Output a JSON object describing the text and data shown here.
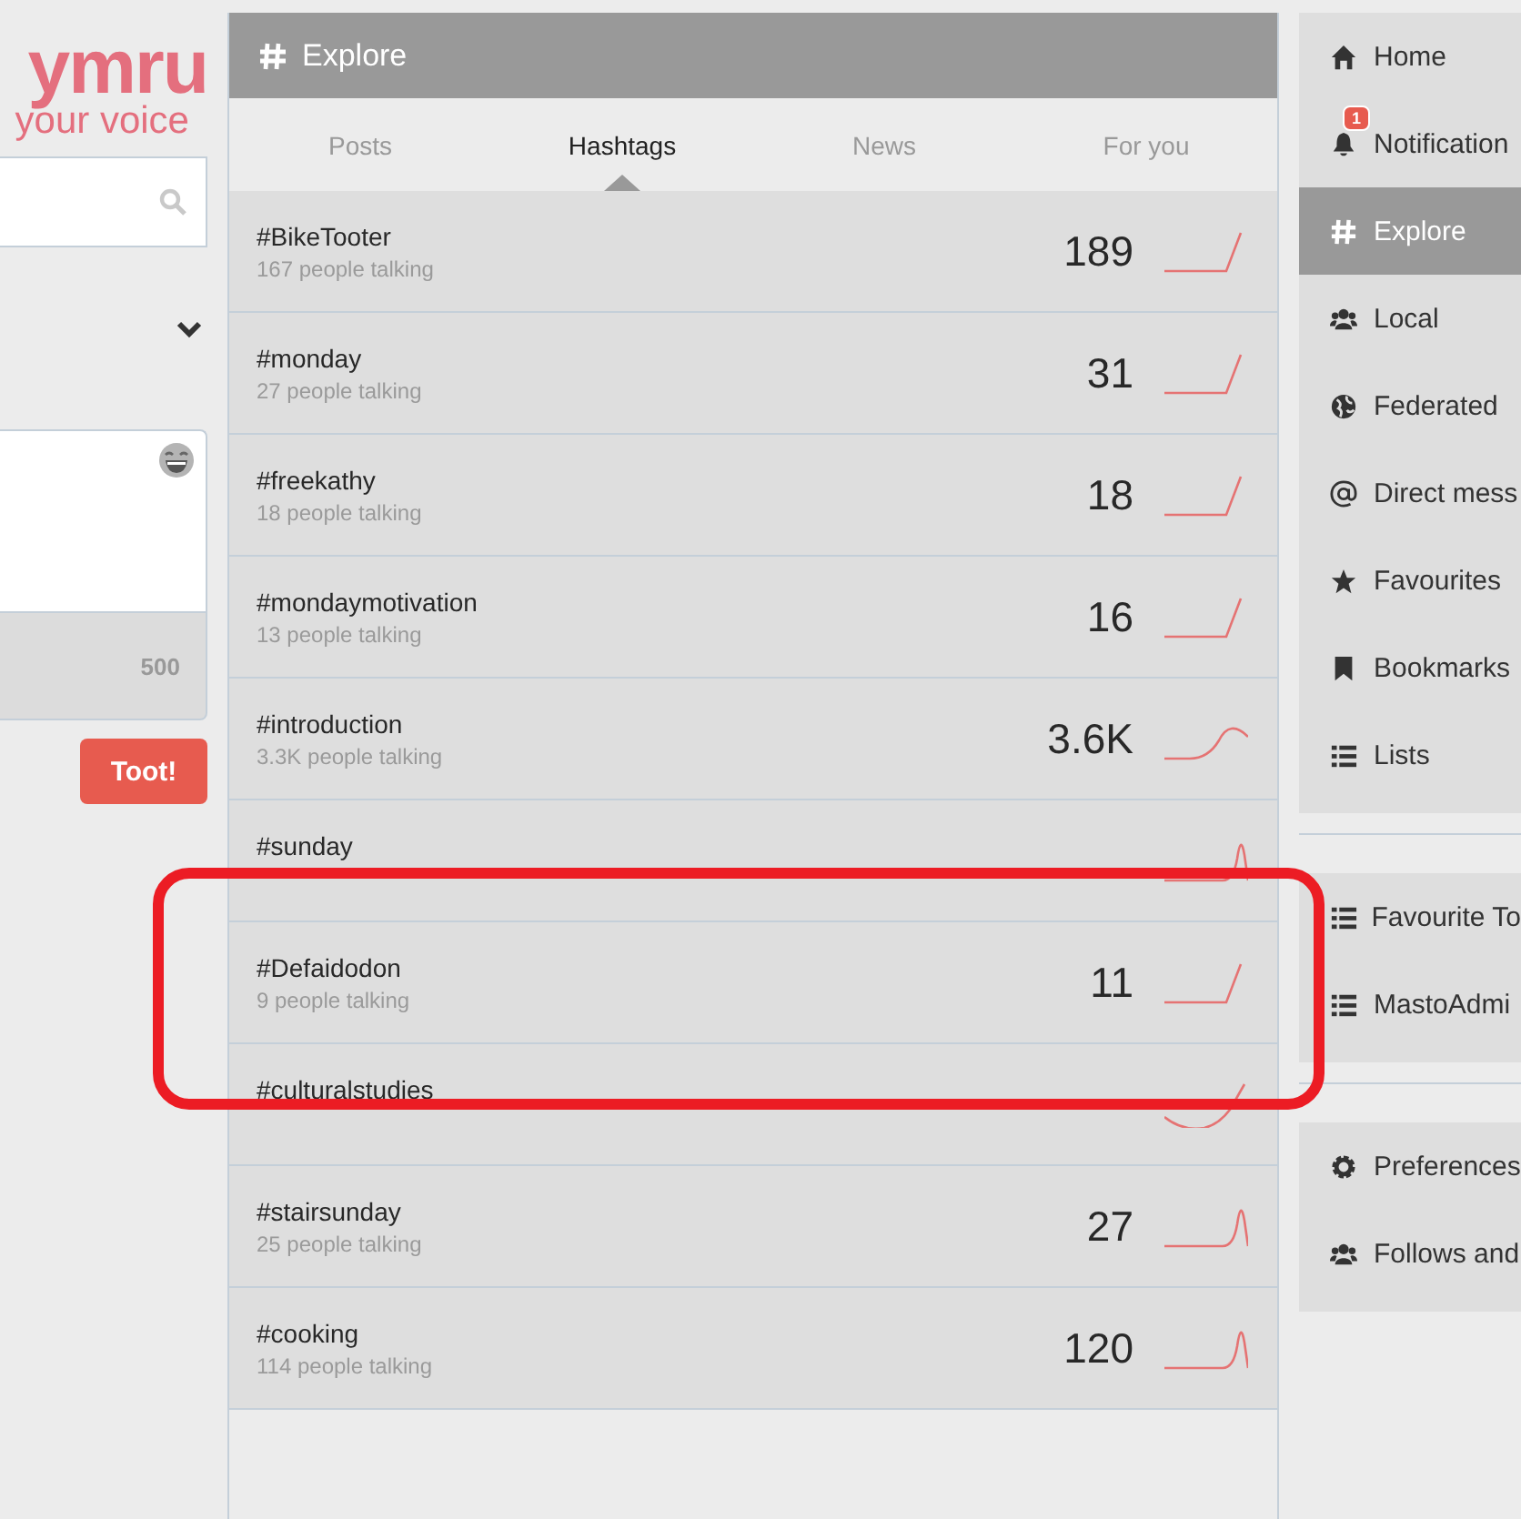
{
  "compose": {
    "logo": "ymru",
    "tagline": "your voice",
    "counter": "500",
    "submit": "Toot!"
  },
  "column": {
    "title": "Explore",
    "tabs": [
      {
        "label": "Posts",
        "selected": false
      },
      {
        "label": "Hashtags",
        "selected": true
      },
      {
        "label": "News",
        "selected": false
      },
      {
        "label": "For you",
        "selected": false
      }
    ],
    "hashtags": [
      {
        "name": "#BikeTooter",
        "talking": "167 people talking",
        "count": "189",
        "kind": "rise"
      },
      {
        "name": "#monday",
        "talking": "27 people talking",
        "count": "31",
        "kind": "rise"
      },
      {
        "name": "#freekathy",
        "talking": "18 people talking",
        "count": "18",
        "kind": "rise"
      },
      {
        "name": "#mondaymotivation",
        "talking": "13 people talking",
        "count": "16",
        "kind": "rise"
      },
      {
        "name": "#introduction",
        "talking": "3.3K people talking",
        "count": "3.6K",
        "kind": "hump"
      },
      {
        "name": "#sunday",
        "kind": "peak"
      },
      {
        "name": "#Defaidodon",
        "talking": "9 people talking",
        "count": "11",
        "kind": "rise"
      },
      {
        "name": "#culturalstudies",
        "kind": "dip"
      },
      {
        "name": "#stairsunday",
        "talking": "25 people talking",
        "count": "27",
        "kind": "peak"
      },
      {
        "name": "#cooking",
        "talking": "114 people talking",
        "count": "120",
        "kind": "peak"
      }
    ]
  },
  "navigation": [
    [
      {
        "label": "Home",
        "selected": false
      },
      {
        "label": "Notification",
        "badge": "1",
        "selected": false
      },
      {
        "label": "Explore",
        "selected": true
      },
      {
        "label": "Local",
        "selected": false
      },
      {
        "label": "Federated",
        "selected": false
      },
      {
        "label": "Direct mess",
        "selected": false
      },
      {
        "label": "Favourites",
        "selected": false
      },
      {
        "label": "Bookmarks",
        "selected": false
      },
      {
        "label": "Lists",
        "selected": false
      }
    ],
    [
      {
        "label": "Favourite To",
        "selected": false
      },
      {
        "label": "MastoAdmi",
        "selected": false
      }
    ],
    [
      {
        "label": "Preferences",
        "selected": false
      },
      {
        "label": "Follows and",
        "selected": false
      }
    ]
  ]
}
